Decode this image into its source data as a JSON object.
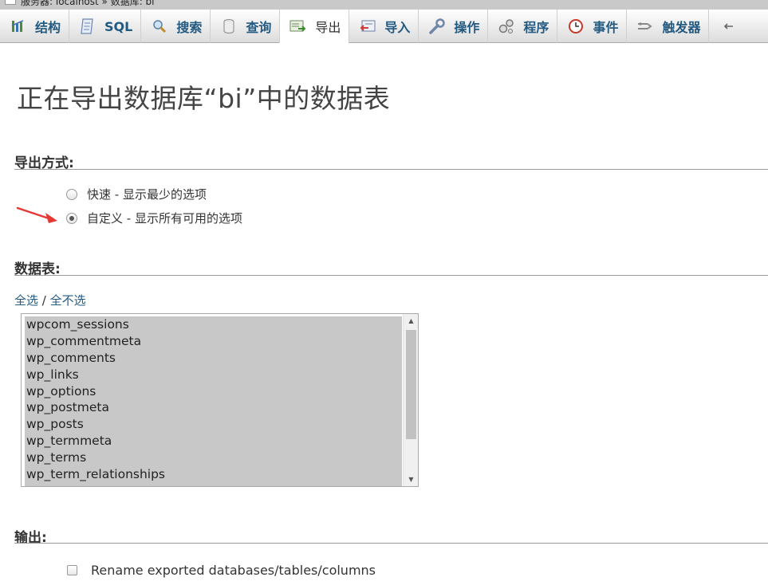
{
  "breadcrumb": {
    "text": "服务器: localhost » 数据库: bi"
  },
  "tabs": [
    {
      "label": "结构",
      "icon": "structure-icon"
    },
    {
      "label": "SQL",
      "icon": "sql-icon"
    },
    {
      "label": "搜索",
      "icon": "search-icon"
    },
    {
      "label": "查询",
      "icon": "query-icon"
    },
    {
      "label": "导出",
      "icon": "export-icon",
      "active": true
    },
    {
      "label": "导入",
      "icon": "import-icon"
    },
    {
      "label": "操作",
      "icon": "wrench-icon"
    },
    {
      "label": "程序",
      "icon": "routines-icon"
    },
    {
      "label": "事件",
      "icon": "clock-icon"
    },
    {
      "label": "触发器",
      "icon": "triggers-icon"
    }
  ],
  "page": {
    "title": "正在导出数据库“bi”中的数据表"
  },
  "export_method": {
    "heading": "导出方式:",
    "options": [
      {
        "label": "快速 - 显示最少的选项",
        "checked": false
      },
      {
        "label": "自定义 - 显示所有可用的选项",
        "checked": true
      }
    ]
  },
  "tables": {
    "heading": "数据表:",
    "select_all": "全选",
    "separator": "/",
    "select_none": "全不选",
    "items": [
      "wpcom_sessions",
      "wp_commentmeta",
      "wp_comments",
      "wp_links",
      "wp_options",
      "wp_postmeta",
      "wp_posts",
      "wp_termmeta",
      "wp_terms",
      "wp_term_relationships"
    ]
  },
  "output": {
    "heading": "输出:",
    "rename_label": "Rename exported databases/tables/columns",
    "rename_checked": false
  },
  "colors": {
    "link": "#235a81",
    "arrow": "#e53935",
    "selection": "#c8c8c8"
  }
}
